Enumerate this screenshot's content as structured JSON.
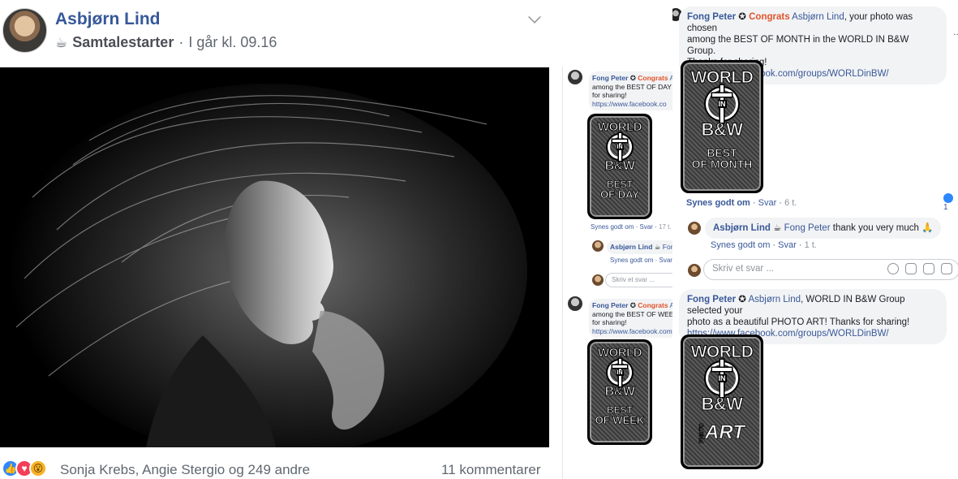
{
  "post": {
    "author": "Asbjørn Lind",
    "feeling_icon": "coffee-cup-icon",
    "feeling": "Samtalestarter",
    "separator": "·",
    "timestamp": "I går kl. 09.16",
    "reaction_icons": [
      "like-icon",
      "love-icon",
      "wow-icon"
    ],
    "reaction_names": "Sonja Krebs, Angie Stergio og 249 andre",
    "comment_count": "11 kommentarer"
  },
  "mini_thread": {
    "c1": {
      "author": "Fong Peter",
      "congrats": "Congrats",
      "tag": "As",
      "line2": "among the BEST OF DAY i",
      "line3": "for sharing!",
      "link": "https://www.facebook.co"
    },
    "c1_badge": {
      "title1": "WORLD",
      "title2": "B&W",
      "ring": "IN",
      "sub1": "BEST",
      "sub2": "OF DAY"
    },
    "c1_actions": {
      "like": "Synes godt om",
      "reply": "Svar",
      "time": "17 t."
    },
    "c1_reply": {
      "author": "Asbjørn Lind",
      "tag": "Fon"
    },
    "c1_reply_actions": {
      "like": "Synes godt om",
      "reply": "Svar"
    },
    "c1_input_placeholder": "Skriv et svar ...",
    "c2": {
      "author": "Fong Peter",
      "congrats": "Congrats",
      "tag": "A",
      "line2": "among the BEST OF WEEK",
      "line3": "for sharing!",
      "link": "https://www.facebook.com"
    },
    "c2_badge": {
      "title1": "WORLD",
      "title2": "B&W",
      "ring": "IN",
      "sub1": "BEST",
      "sub2": "OF WEEK"
    }
  },
  "thread": {
    "c1": {
      "author": "Fong Peter",
      "congrats": "Congrats",
      "tag": "Asbjørn Lind",
      "text1": ", your photo was chosen",
      "text2": "among the BEST OF MONTH in the WORLD IN B&W Group.",
      "text3": "Thanks for sharing!",
      "link": "https://www.facebook.com/groups/WORLDinBW/"
    },
    "c1_badge": {
      "title1": "WORLD",
      "title2": "B&W",
      "ring": "IN",
      "sub1": "BEST",
      "sub2": "OF MONTH"
    },
    "c1_actions": {
      "like": "Synes godt om",
      "reply": "Svar",
      "time": "6 t."
    },
    "c1_like_count": "1",
    "reply": {
      "author": "Asbjørn Lind",
      "tag": "Fong Peter",
      "text": "thank you very much 🙏"
    },
    "reply_actions": {
      "like": "Synes godt om",
      "reply": "Svar",
      "time": "1 t."
    },
    "reply_input_placeholder": "Skriv et svar ...",
    "c2": {
      "author": "Fong Peter",
      "tag": "Asbjørn Lind",
      "text1": ", WORLD IN B&W Group selected your",
      "text2": "photo as a beautiful PHOTO ART! Thanks for sharing!",
      "link": "https://www.facebook.com/groups/WORLDinBW/"
    },
    "c2_badge": {
      "title1": "WORLD",
      "title2": "B&W",
      "ring": "IN",
      "sub1": "PHOTO",
      "sub2": "ART"
    },
    "overflow": "..."
  }
}
